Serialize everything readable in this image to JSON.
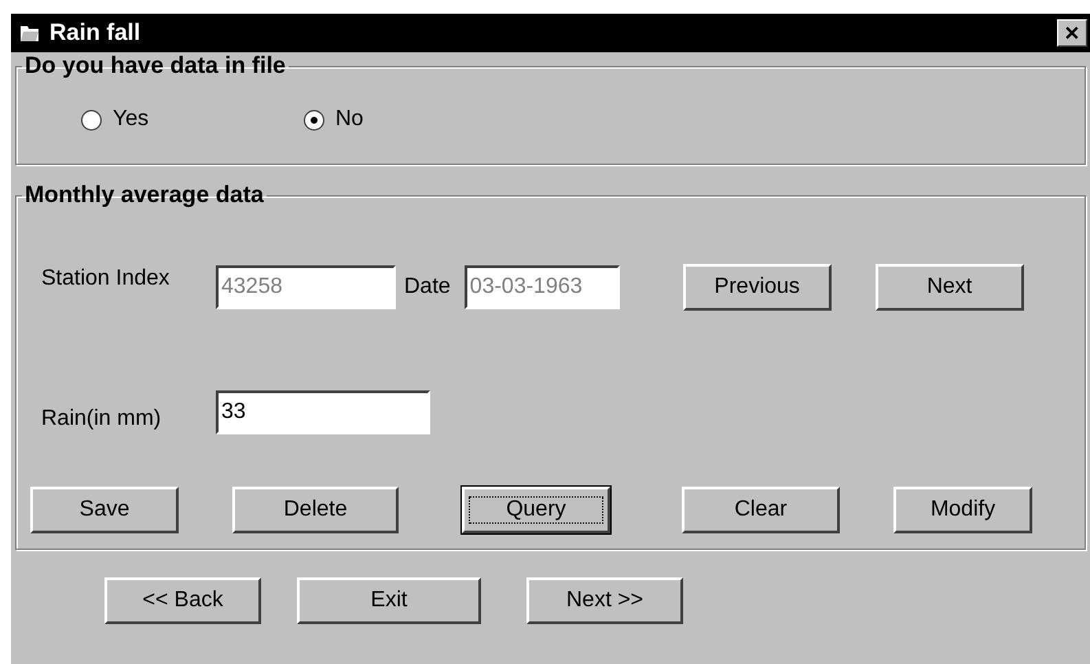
{
  "window": {
    "title": "Rain fall",
    "close": "✕"
  },
  "file_group": {
    "legend": "Do you have data in file",
    "options": [
      {
        "label": "Yes",
        "selected": false
      },
      {
        "label": "No",
        "selected": true
      }
    ]
  },
  "monthly_group": {
    "legend": "Monthly average data",
    "station_index": {
      "label": "Station Index",
      "value": "43258",
      "disabled": true
    },
    "date": {
      "label": "Date",
      "value": "03-03-1963",
      "disabled": true
    },
    "nav_buttons": [
      {
        "label": "Previous",
        "focused": false
      },
      {
        "label": "Next",
        "focused": false
      }
    ],
    "rain": {
      "label": "Rain(in mm)",
      "value": "33",
      "disabled": false
    },
    "actions": [
      {
        "label": "Save",
        "focused": false
      },
      {
        "label": "Delete",
        "focused": false
      },
      {
        "label": "Query",
        "focused": true
      },
      {
        "label": "Clear",
        "focused": false
      },
      {
        "label": "Modify",
        "focused": false
      }
    ]
  },
  "footer_buttons": [
    {
      "label": "<< Back",
      "focused": false
    },
    {
      "label": "Exit",
      "focused": false
    },
    {
      "label": "Next >>",
      "focused": false
    }
  ]
}
